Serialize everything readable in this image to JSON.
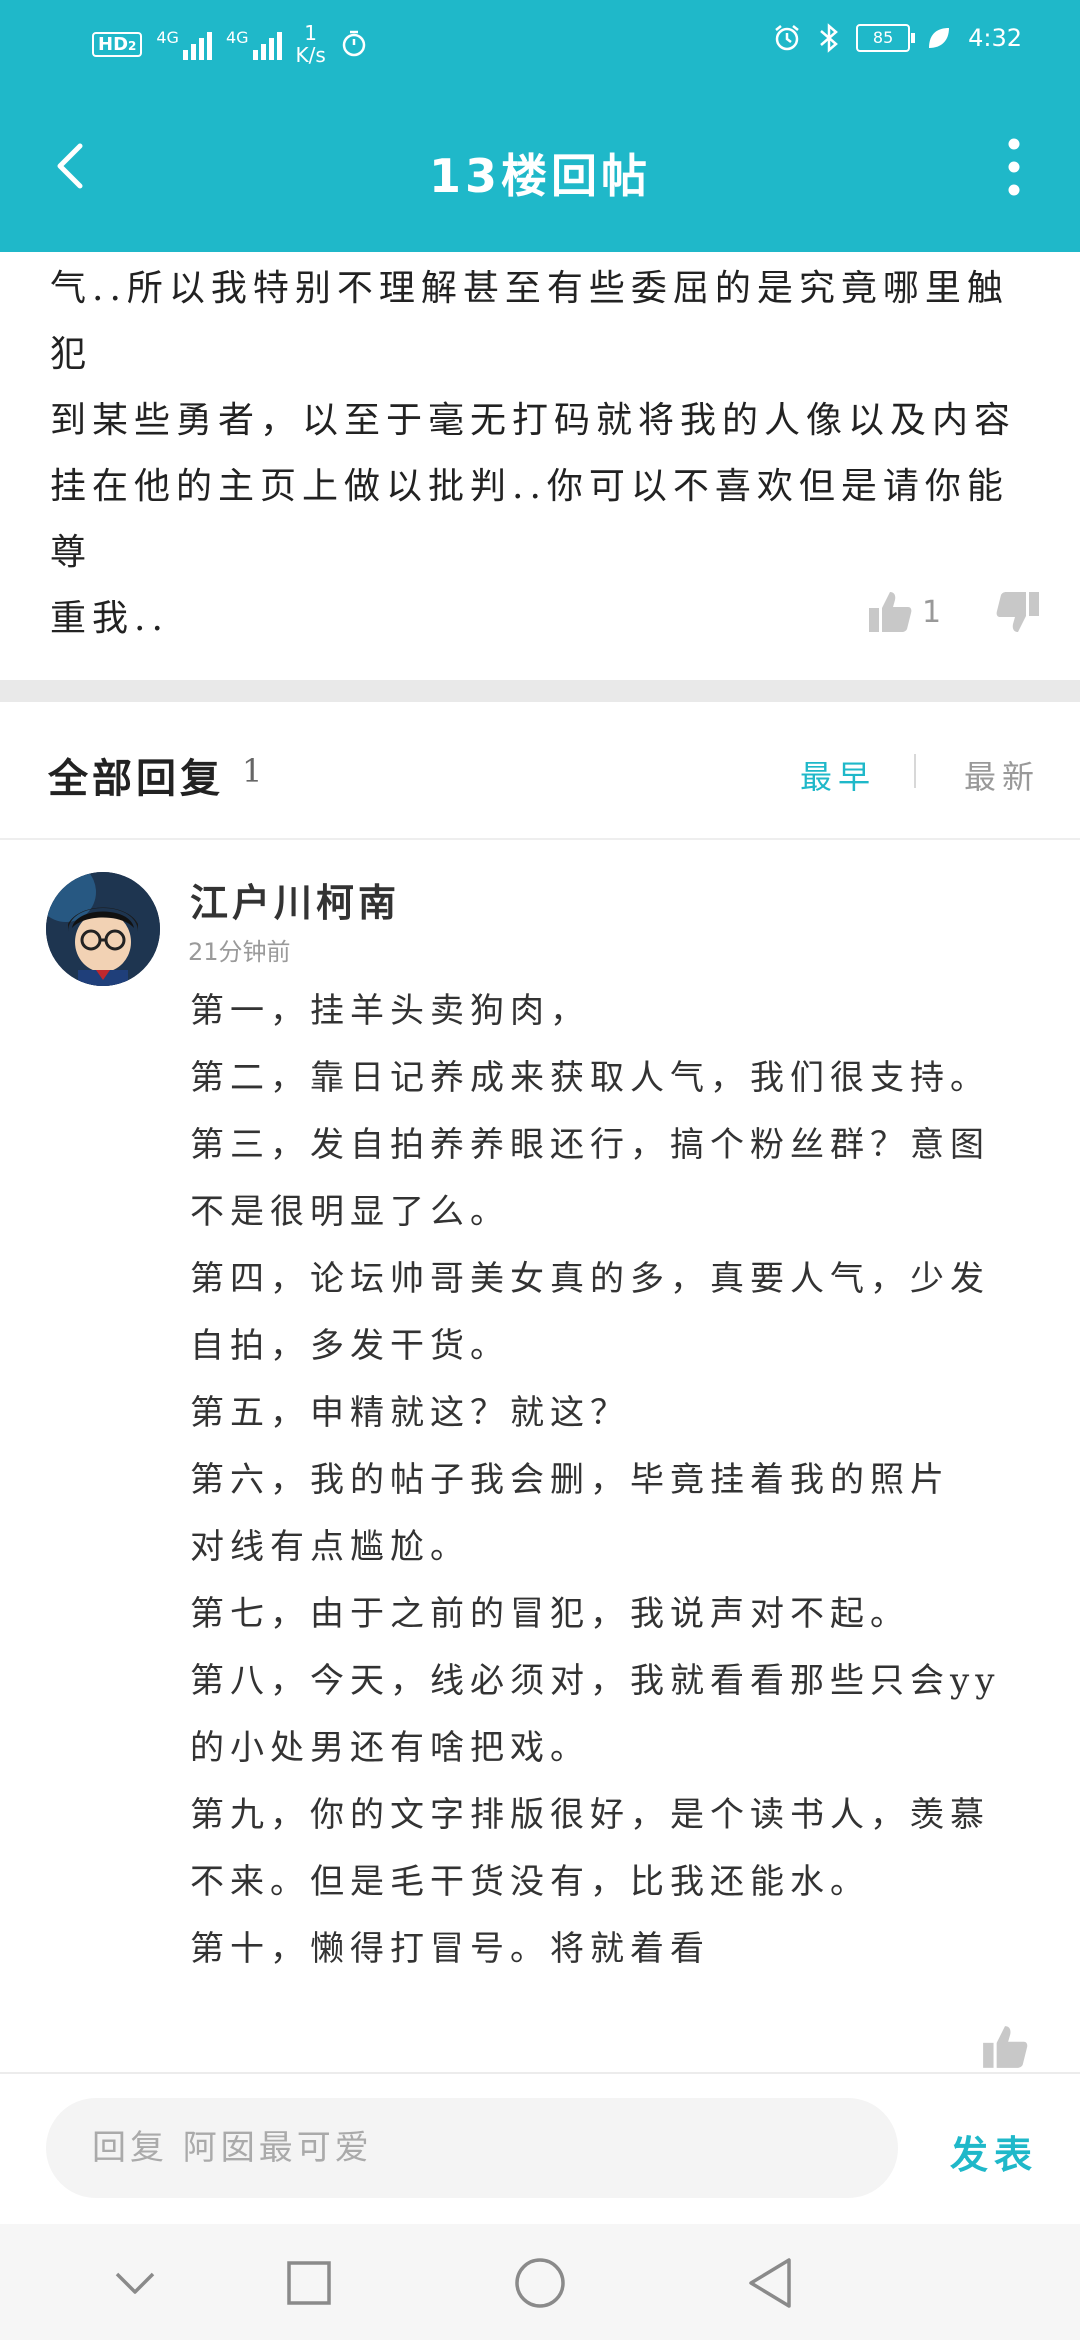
{
  "status_bar": {
    "network_badge": "HD",
    "network_badge_sub": "2",
    "sim1_type": "4G",
    "sim2_type": "4G",
    "speed_value": "1",
    "speed_unit": "K/s",
    "battery": "85",
    "time": "4:32"
  },
  "header": {
    "title": "13楼回帖"
  },
  "post": {
    "lines": [
      "气..所以我特别不理解甚至有些委屈的是究竟哪里触犯",
      "到某些勇者，以至于毫无打码就将我的人像以及内容",
      "挂在他的主页上做以批判..你可以不喜欢但是请你能尊",
      "重我.."
    ],
    "like_count": "1"
  },
  "replies": {
    "title": "全部回复",
    "count": "1",
    "sort_earliest": "最早",
    "sort_newest": "最新",
    "items": [
      {
        "author": "江户川柯南",
        "time": "21分钟前",
        "lines": [
          "第一，挂羊头卖狗肉，",
          "第二，靠日记养成来获取人气，我们很支持。",
          "第三，发自拍养养眼还行，搞个粉丝群？意图",
          "不是很明显了么。",
          "第四，论坛帅哥美女真的多，真要人气，少发",
          "自拍，多发干货。",
          "第五，申精就这？就这？",
          "第六，我的帖子我会删，毕竟挂着我的照片",
          "对线有点尴尬。",
          "第七，由于之前的冒犯，我说声对不起。",
          "第八，今天，线必须对，我就看看那些只会yy",
          "的小处男还有啥把戏。",
          "第九，你的文字排版很好，是个读书人，羡慕",
          "不来。但是毛干货没有，比我还能水。",
          "第十，懒得打冒号。将就着看"
        ]
      }
    ]
  },
  "input_bar": {
    "placeholder": "回复 阿囡最可爱",
    "publish_label": "发表"
  },
  "colors": {
    "accent": "#1fb8c9",
    "muted": "#999999"
  },
  "icons": [
    "back-arrow-icon",
    "more-vert-icon",
    "thumb-up-icon",
    "thumb-down-icon",
    "nav-down-icon",
    "nav-square-icon",
    "nav-circle-icon",
    "nav-back-triangle-icon"
  ]
}
